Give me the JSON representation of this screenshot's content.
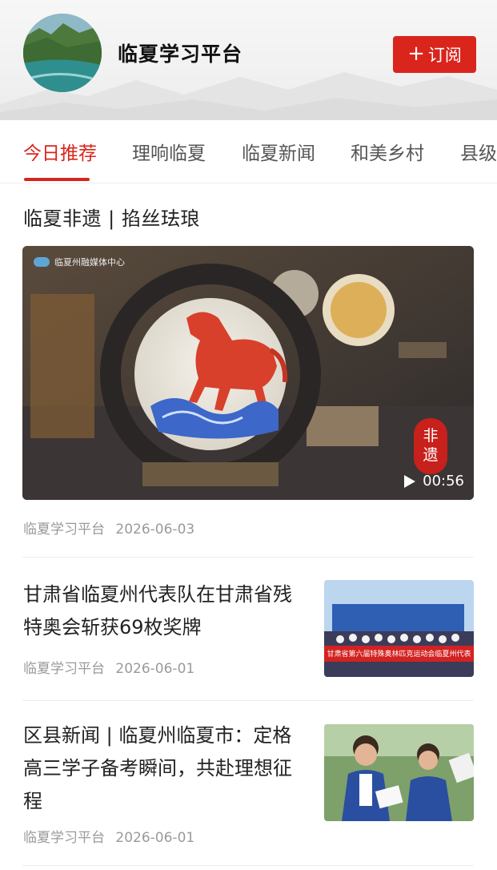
{
  "header": {
    "platform_name": "临夏学习平台",
    "subscribe_label": "订阅",
    "subscribe_icon": "plus-icon"
  },
  "tabs": [
    {
      "label": "今日推荐",
      "active": true
    },
    {
      "label": "理响临夏",
      "active": false
    },
    {
      "label": "临夏新闻",
      "active": false
    },
    {
      "label": "和美乡村",
      "active": false
    },
    {
      "label": "县级",
      "active": false
    }
  ],
  "colors": {
    "accent": "#d9251c",
    "meta_text": "#9a9a9a"
  },
  "feature": {
    "title": "临夏非遗 | 掐丝珐琅",
    "watermark": "临夏州融媒体中心",
    "stamp_text": [
      "非",
      "遗"
    ],
    "duration": "00:56",
    "play_icon": "play-icon",
    "source": "临夏学习平台",
    "date": "2026-06-03"
  },
  "articles": [
    {
      "title": "甘肃省临夏州代表队在甘肃省残特奥会斩获69枚奖牌",
      "source": "临夏学习平台",
      "date": "2026-06-01",
      "banner_text": "甘肃省第六届特殊奥林匹克运动会临夏州代表"
    },
    {
      "title": "区县新闻 | 临夏州临夏市：定格高三学子备考瞬间，共赴理想征程",
      "source": "临夏学习平台",
      "date": "2026-06-01"
    }
  ]
}
